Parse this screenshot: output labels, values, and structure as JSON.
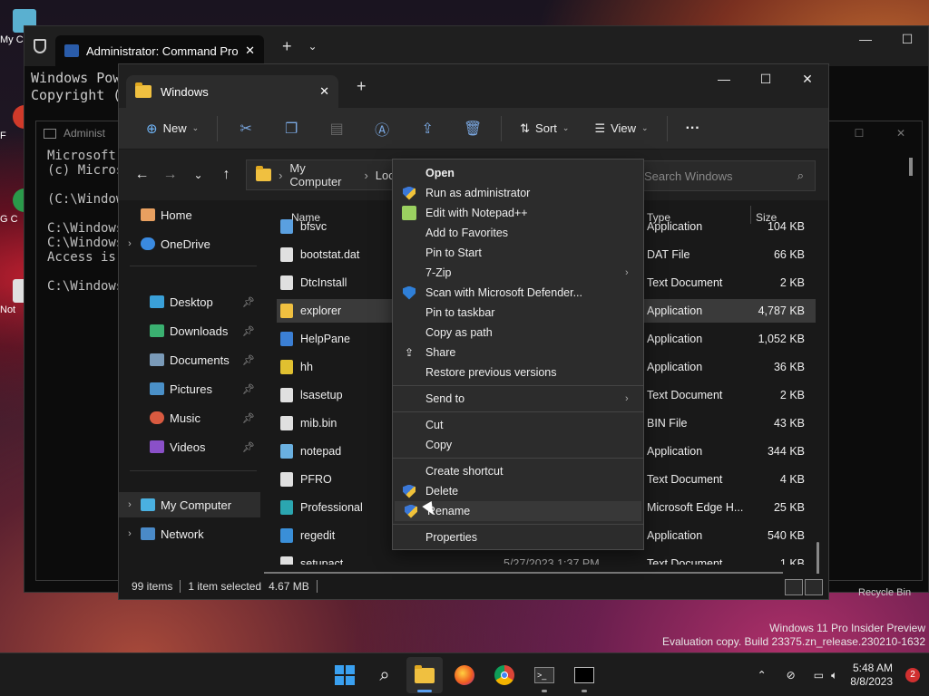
{
  "desktop": {
    "icons": [
      {
        "label": "My C"
      },
      {
        "label": "F"
      },
      {
        "label": "G C"
      },
      {
        "label": "Not"
      }
    ],
    "recycle_bin_label": "Recycle Bin",
    "watermark": {
      "line1": "Windows 11 Pro Insider Preview",
      "line2": "Evaluation copy. Build 23375.zn_release.230210-1632"
    }
  },
  "terminal": {
    "tab_title": "Administrator: Command Pro",
    "text": "Windows Pow\nCopyright (",
    "console": {
      "title": "Administ",
      "text": "Microsoft W\n(c) Microso\n\n(C:\\Windows\\S\n\nC:\\Windows>c\nC:\\Windows\\(\nAccess is de\n\nC:\\Windows>"
    }
  },
  "explorer": {
    "tab_label": "Windows",
    "toolbar": {
      "new_label": "New",
      "sort_label": "Sort",
      "view_label": "View"
    },
    "address": {
      "path_root": "My Computer",
      "path_next": "Loca"
    },
    "search_placeholder": "Search Windows",
    "nav": {
      "home": "Home",
      "onedrive": "OneDrive",
      "desktop": "Desktop",
      "downloads": "Downloads",
      "documents": "Documents",
      "pictures": "Pictures",
      "music": "Music",
      "videos": "Videos",
      "my_computer": "My Computer",
      "network": "Network"
    },
    "columns": {
      "name": "Name",
      "type": "Type",
      "size": "Size"
    },
    "files": [
      {
        "name": "bfsvc",
        "type": "Application",
        "size": "104 KB",
        "color": "#5aa0e0"
      },
      {
        "name": "bootstat.dat",
        "type": "DAT File",
        "size": "66 KB",
        "color": "#e0e0e0"
      },
      {
        "name": "DtcInstall",
        "type": "Text Document",
        "size": "2 KB",
        "color": "#e0e0e0"
      },
      {
        "name": "explorer",
        "type": "Application",
        "size": "4,787 KB",
        "color": "#f0c040"
      },
      {
        "name": "HelpPane",
        "type": "Application",
        "size": "1,052 KB",
        "color": "#3b7fd4"
      },
      {
        "name": "hh",
        "type": "Application",
        "size": "36 KB",
        "color": "#e0c030"
      },
      {
        "name": "lsasetup",
        "type": "Text Document",
        "size": "2 KB",
        "color": "#e0e0e0"
      },
      {
        "name": "mib.bin",
        "type": "BIN File",
        "size": "43 KB",
        "color": "#e0e0e0"
      },
      {
        "name": "notepad",
        "type": "Application",
        "size": "344 KB",
        "color": "#6ab0e0"
      },
      {
        "name": "PFRO",
        "type": "Text Document",
        "size": "4 KB",
        "color": "#e0e0e0"
      },
      {
        "name": "Professional",
        "type": "Microsoft Edge H...",
        "size": "25 KB",
        "color": "#2ba6b0"
      },
      {
        "name": "regedit",
        "type": "Application",
        "size": "540 KB",
        "color": "#3a8fd8"
      },
      {
        "name": "setupact",
        "type": "Text Document",
        "size": "1 KB",
        "date": "5/27/2023 1:37 PM",
        "color": "#e0e0e0"
      }
    ],
    "status": {
      "items": "99 items",
      "selected": "1 item selected",
      "size": "4.67 MB"
    }
  },
  "context_menu": {
    "items": [
      {
        "label": "Open",
        "bold": true
      },
      {
        "label": "Run as administrator",
        "icon": "shield"
      },
      {
        "label": "Edit with Notepad++",
        "icon": "notepadpp"
      },
      {
        "label": "Add to Favorites"
      },
      {
        "label": "Pin to Start"
      },
      {
        "label": "7-Zip",
        "submenu": true
      },
      {
        "label": "Scan with Microsoft Defender...",
        "icon": "defender"
      },
      {
        "label": "Pin to taskbar"
      },
      {
        "label": "Copy as path"
      },
      {
        "label": "Share",
        "icon": "share"
      },
      {
        "label": "Restore previous versions"
      },
      {
        "label": "Send to",
        "submenu": true
      },
      {
        "label": "Cut"
      },
      {
        "label": "Copy"
      },
      {
        "label": "Create shortcut"
      },
      {
        "label": "Delete",
        "icon": "shield"
      },
      {
        "label": "Rename",
        "icon": "shield",
        "hover": true
      },
      {
        "label": "Properties"
      }
    ]
  },
  "taskbar": {
    "time": "5:48 AM",
    "date": "8/8/2023",
    "notification_count": "2"
  }
}
